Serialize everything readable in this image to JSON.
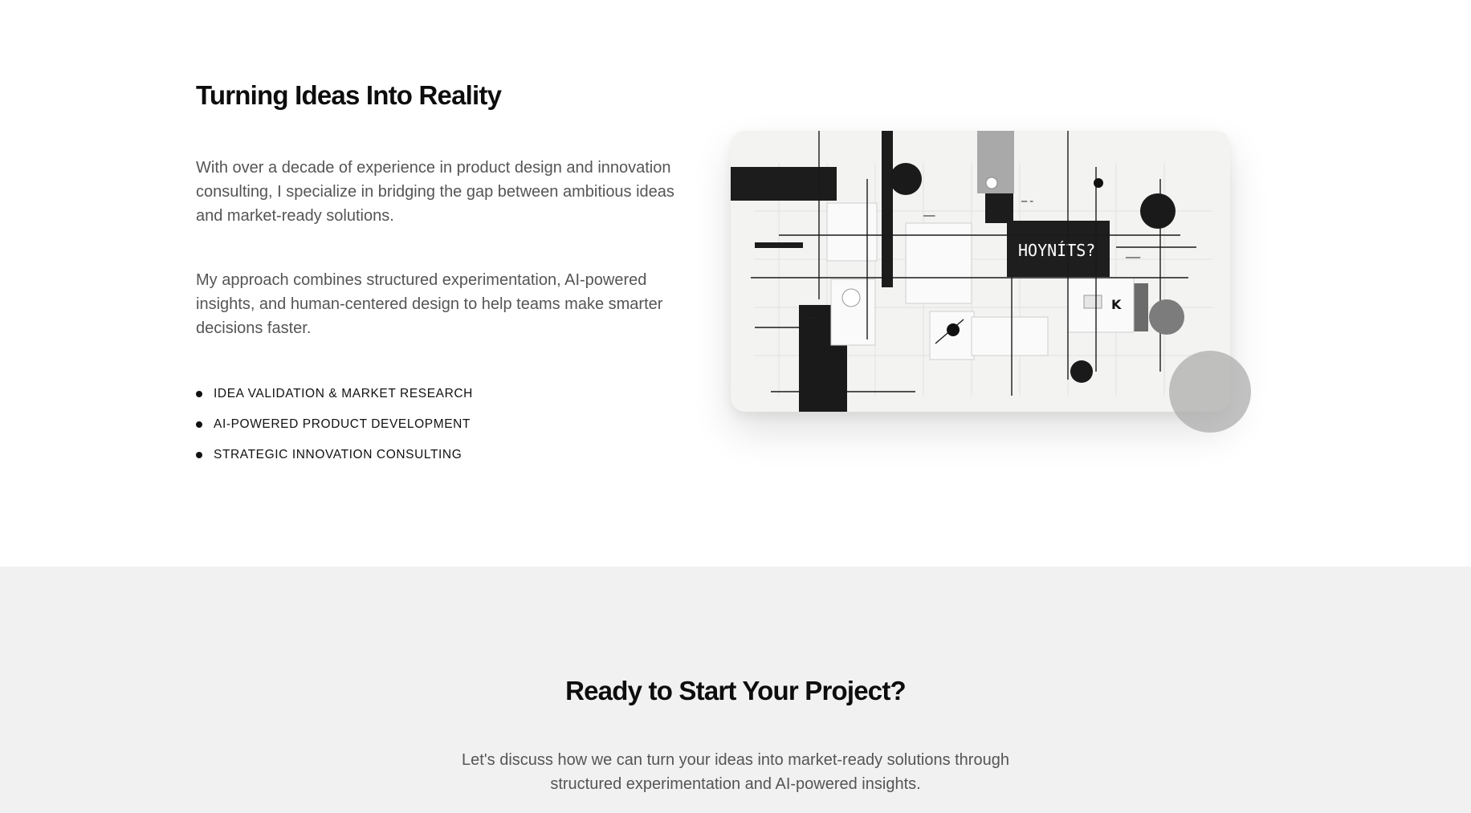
{
  "about": {
    "title": "Turning Ideas Into Reality",
    "paragraph_1": "With over a decade of experience in product design and innovation consulting, I specialize in bridging the gap between ambitious ideas and market-ready solutions.",
    "paragraph_2": "My approach combines structured experimentation, AI-powered insights, and human-centered design to help teams make smarter decisions faster.",
    "services": [
      "IDEA VALIDATION & MARKET RESEARCH",
      "AI-POWERED PRODUCT DEVELOPMENT",
      "STRATEGIC INNOVATION CONSULTING"
    ],
    "image": {
      "label_main": "HOYNÍTS?",
      "label_k": "K"
    }
  },
  "cta": {
    "title": "Ready to Start Your Project?",
    "paragraph": "Let's discuss how we can turn your ideas into market-ready solutions through structured experimentation and AI-powered insights."
  },
  "colors": {
    "page_background": "#ffffff",
    "cta_background": "#f1f1f1",
    "heading": "#0d0d0d",
    "body_text": "#555555",
    "accent_dark": "#1a1a1a"
  }
}
